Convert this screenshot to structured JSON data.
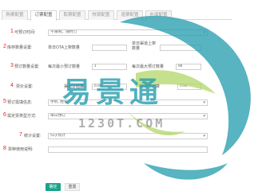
{
  "tabs": [
    "购票配置",
    "订票配置",
    "取票配置",
    "核销配置",
    "退票配置",
    "补填配置"
  ],
  "active_tab_index": 1,
  "fields": {
    "f1": {
      "num": "1",
      "label": "可预订时间:",
      "value": "不限制，随时订"
    },
    "f2": {
      "num": "2",
      "label": "库存数量设置:",
      "label_a": "单日OTA上架数量",
      "value_a": "",
      "label_b": "单日渠道上架数量",
      "value_b": ""
    },
    "f3": {
      "num": "3",
      "label": "预订数量设置:",
      "label_a": "每次最小预订数量",
      "value_a": "1",
      "label_b": "每次最大预订数量",
      "value_b": "99"
    },
    "f4": {
      "num": "4",
      "label": "票价设置:",
      "label_a": "渠道价结算",
      "value_a": "0.00",
      "label_b": "渠道价结算",
      "value_b": "0.00"
    },
    "f5": {
      "num": "5",
      "label": "预订需填信息:",
      "value": "手机, 姓名"
    },
    "f6": {
      "num": "6",
      "label": "需定票类型方式:",
      "value": "单日预订"
    },
    "f7": {
      "num": "7",
      "label": "统计设置:",
      "value": "归于统计"
    },
    "f8": {
      "num": "8",
      "label": "票种使用说明:",
      "value": ""
    }
  },
  "buttons": {
    "ok": "确定",
    "reset": "重置"
  },
  "watermark": {
    "main": "易景通",
    "sub": "1230T.COM"
  },
  "colors": {
    "accent": "#1aa389",
    "number_red": "#e1251b",
    "watermark_teal": "#2a9fb0"
  }
}
